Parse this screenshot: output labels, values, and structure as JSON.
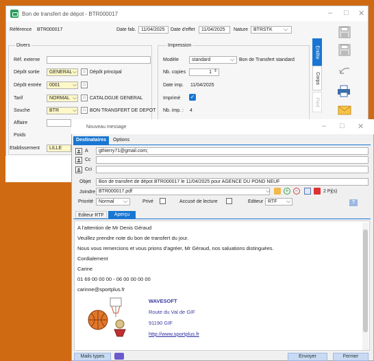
{
  "win1": {
    "title": "Bon de transfert de dépot - BTR000017",
    "reference_label": "Référence",
    "reference_value": "BTR000017",
    "date_fab_label": "Date fab.",
    "date_fab_value": "11/04/2025",
    "date_effet_label": "Date d'effet",
    "date_effet_value": "11/04/2025",
    "nature_label": "Nature",
    "nature_value": "BTRSTK",
    "divers_title": "Divers",
    "ref_externe_label": "Réf. externe",
    "depot_sortie_label": "Dépôt sortie",
    "depot_sortie_value": "GENERAL",
    "depot_sortie_desc": "Dépôt principal",
    "depot_entree_label": "Dépôt entrée",
    "depot_entree_value": "0001",
    "tarif_label": "Tarif",
    "tarif_value": "NORMAL",
    "tarif_desc": "CATALOGUE GENERAL",
    "souche_label": "Souche",
    "souche_value": "BTR",
    "souche_desc": "BON TRANSFERT DE DEPOT",
    "affaire_label": "Affaire",
    "poids_label": "Poids",
    "etab_label": "Etablissement",
    "etab_value": "LILLE",
    "impression_title": "Impression",
    "modele_label": "Modèle",
    "modele_value": "standard",
    "modele_desc": "Bon de Transfert standard",
    "nb_copies_label": "Nb. copies",
    "nb_copies_value": "1",
    "date_imp_label": "Date imp.",
    "date_imp_value": "11/04/2025",
    "imprime_label": "Imprimé",
    "nb_imp_label": "Nb. imp. :",
    "nb_imp_value": "4",
    "tab_entete": "Entête",
    "tab_corps": "Corps",
    "tab_pied": "Pied"
  },
  "win2": {
    "title": "Nouveau message",
    "tab_destinataires": "Destinataires",
    "tab_options": "Options",
    "a_label": "A",
    "a_value": "gthierry71@gmail.com;",
    "cc_label": "Cc",
    "cci_label": "Cci",
    "objet_label": "Objet",
    "objet_value": "Bon de transfert de dépot BTR000017 le 11/04/2025 pour AGENCE DU POND NEUF",
    "joindre_label": "Joindre",
    "joindre_value": "BTR000017.pdf",
    "pj_count": "2 Pj(s)",
    "priorite_label": "Priorité",
    "priorite_value": "Normal",
    "prive_label": "Privé",
    "accuse_label": "Accusé de lecture",
    "editeur_label": "Editeur",
    "editeur_value": "RTF",
    "help_label": "?",
    "tab_editeur": "Editeur RTF",
    "tab_apercu": "Aperçu",
    "body": {
      "line1": "A l'attention de Mr Denis Géraud",
      "line2": "Veuillez prendre note du bon de transfert du jour.",
      "line3": "Nous vous remercions et vous prions d'agréer, Mr Géraud, nos saluations distinguées.",
      "line4": "Cordialement",
      "line5": "Carine",
      "line6": "01 69 00 00 00 - 06 00 00 00 00",
      "line7": "carinne@sportplus.fr"
    },
    "signature": {
      "company": "WAVESOFT",
      "street": "Route du Val de GIF",
      "city": "91190 GIF",
      "url": "http://www.sportplus.fr"
    },
    "btn_mails_types": "Mails types",
    "btn_envoyer": "Envoyer",
    "btn_fermer": "Fermer"
  },
  "icons": [
    "app-icon",
    "save-icon",
    "print-icon",
    "undo-icon",
    "mail-icon",
    "home-icon",
    "contact-book-icon",
    "attachment-icon",
    "basketball-logo-icon"
  ]
}
